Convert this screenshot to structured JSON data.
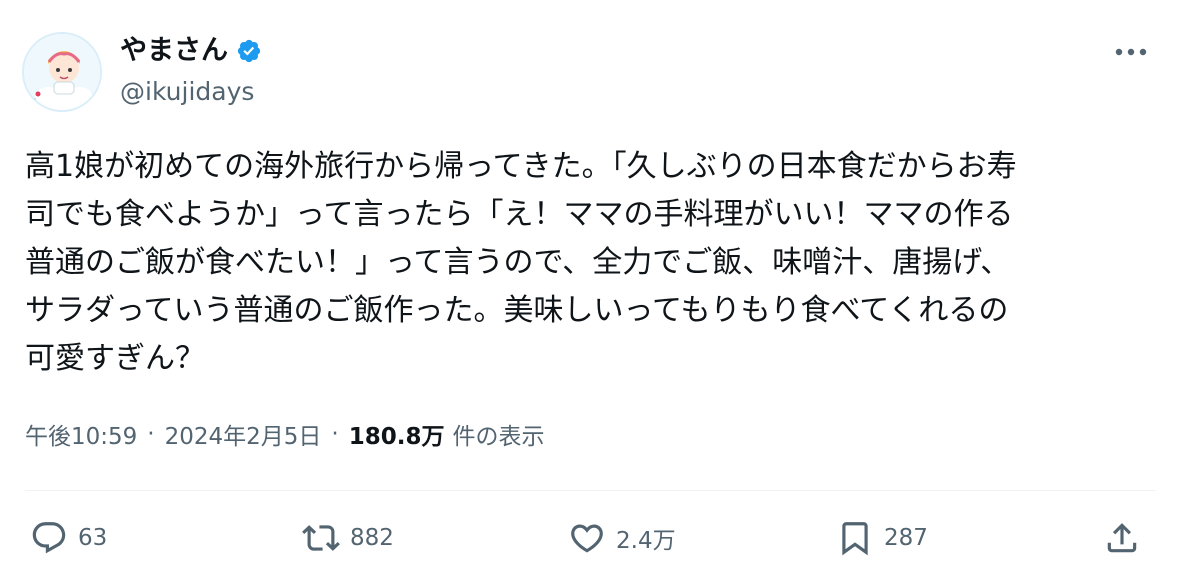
{
  "author": {
    "display_name": "やまさん",
    "handle": "@ikujidays",
    "verified": true
  },
  "tweet": {
    "text": "高1娘が初めての海外旅行から帰ってきた。「久しぶりの日本食だからお寿\n司でも食べようか」って言ったら「え！ママの手料理がいい！ママの作る\n普通のご飯が食べたい！」って言うので、全力でご飯、味噌汁、唐揚げ、\nサラダっていう普通のご飯作った。美味しいってもりもり食べてくれるの\n可愛すぎん？"
  },
  "meta": {
    "time": "午後10:59",
    "separator": "·",
    "date": "2024年2月5日",
    "views_count": "180.8万",
    "views_label": "件の表示"
  },
  "actions": {
    "replies": "63",
    "reposts": "882",
    "likes": "2.4万",
    "bookmarks": "287"
  },
  "icons": {
    "verified": "verified-badge-icon",
    "more": "more-dots-icon",
    "reply": "reply-bubble-icon",
    "repost": "repost-arrows-icon",
    "like": "heart-icon",
    "bookmark": "bookmark-icon",
    "share": "share-upload-icon"
  },
  "colors": {
    "text_primary": "#0f1419",
    "text_secondary": "#536471",
    "verified_blue": "#1d9bf0",
    "divider": "#eff3f4"
  }
}
